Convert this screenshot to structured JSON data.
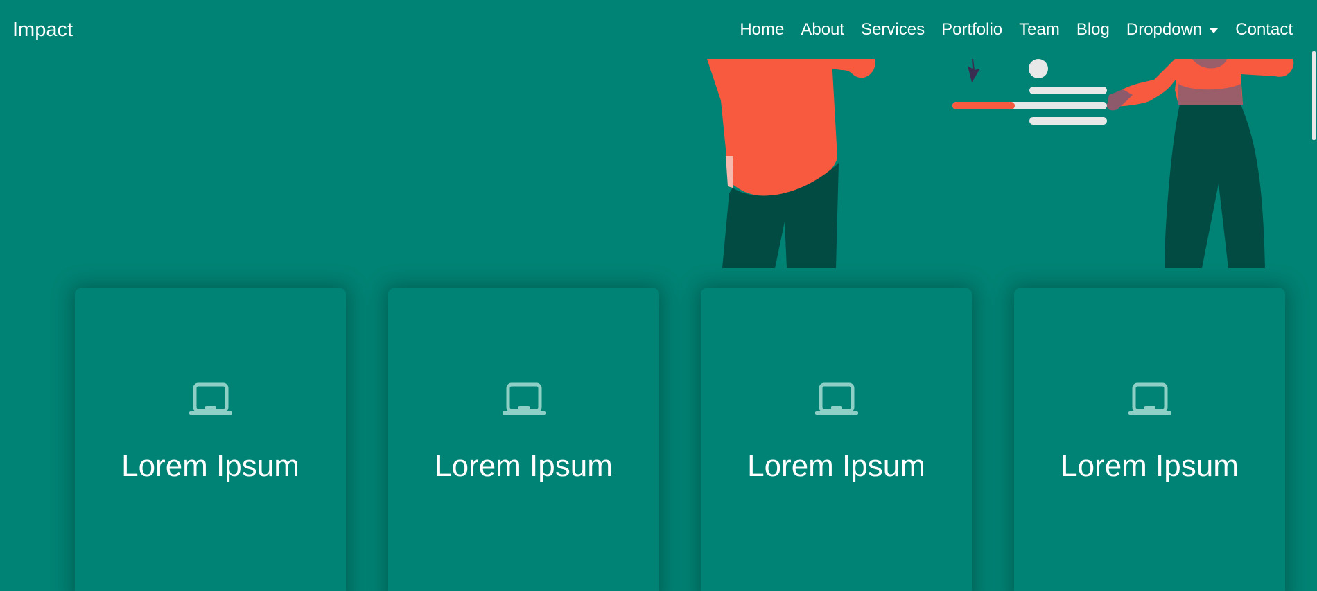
{
  "brand": "Impact",
  "nav": {
    "home": "Home",
    "about": "About",
    "services": "Services",
    "portfolio": "Portfolio",
    "team": "Team",
    "blog": "Blog",
    "dropdown": "Dropdown",
    "contact": "Contact"
  },
  "cards": [
    {
      "title": "Lorem Ipsum",
      "icon": "laptop-icon"
    },
    {
      "title": "Lorem Ipsum",
      "icon": "laptop-icon"
    },
    {
      "title": "Lorem Ipsum",
      "icon": "laptop-icon"
    },
    {
      "title": "Lorem Ipsum",
      "icon": "laptop-icon"
    }
  ],
  "colors": {
    "background": "#008374",
    "accent_orange": "#f85a40",
    "dark_green": "#024b43",
    "icon_light": "#8fd0c6"
  }
}
